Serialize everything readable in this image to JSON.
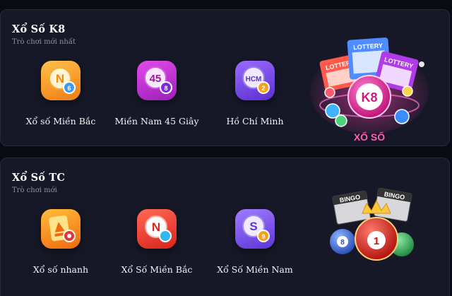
{
  "sections": [
    {
      "title": "Xổ Số K8",
      "subtitle": "Trò chơi mới nhất",
      "games": [
        {
          "label": "Xổ số Miền Bắc",
          "icon": "lottery-ball-n-icon"
        },
        {
          "label": "Miền Nam 45 Giây",
          "icon": "lottery-ball-45-icon"
        },
        {
          "label": "Hồ Chí Minh",
          "icon": "lottery-ball-hcm-icon"
        }
      ],
      "banner": {
        "brand": "K8",
        "caption": "XỔ SỐ",
        "ticket_text": "LOTTERY"
      }
    },
    {
      "title": "Xổ Số TC",
      "subtitle": "Trò chơi mới",
      "games": [
        {
          "label": "Xổ số nhanh",
          "icon": "quick-lottery-icon"
        },
        {
          "label": "Xổ Số Miền Bắc",
          "icon": "lottery-ball-n-icon"
        },
        {
          "label": "Xổ Số Miền Nam",
          "icon": "lottery-ball-s-icon"
        }
      ],
      "banner": {
        "ticket_text": "BINGO",
        "ball_number": "1",
        "ball_number_2": "8"
      }
    }
  ],
  "icon_texts": {
    "n": "N",
    "n2": "N",
    "num45": "45",
    "hcm": "HCM",
    "s": "S",
    "mini6": "6",
    "mini8": "8",
    "mini2": "2",
    "mini9": "9"
  },
  "colors": {
    "background": "#0a0b12",
    "panel": "#161827",
    "orange": "#f6a12a",
    "magenta": "#c237d6",
    "purple": "#7a45e6",
    "red": "#e8362f",
    "pink_text": "#ff5fb4"
  }
}
